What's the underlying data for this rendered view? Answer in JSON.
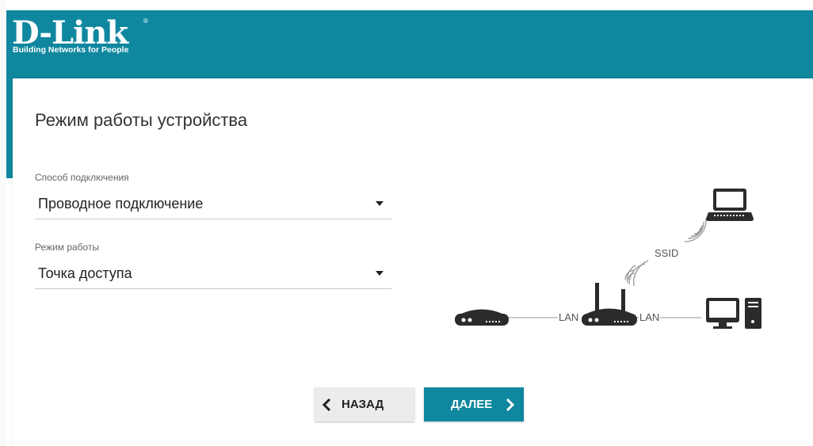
{
  "header": {
    "logo_text": "D-Link",
    "logo_tagline": "Building Networks for People",
    "logo_registered": "®"
  },
  "page": {
    "title": "Режим работы устройства"
  },
  "connection_method": {
    "label": "Способ подключения",
    "value": "Проводное подключение"
  },
  "work_mode": {
    "label": "Режим работы",
    "value": "Точка доступа"
  },
  "diagram": {
    "ssid_label": "SSID",
    "lan_left_label": "LAN",
    "lan_right_label": "LAN"
  },
  "buttons": {
    "back_label": "НАЗАД",
    "next_label": "ДАЛЕЕ"
  },
  "colors": {
    "brand": "#0f879f",
    "icon": "#2b2b2b"
  }
}
